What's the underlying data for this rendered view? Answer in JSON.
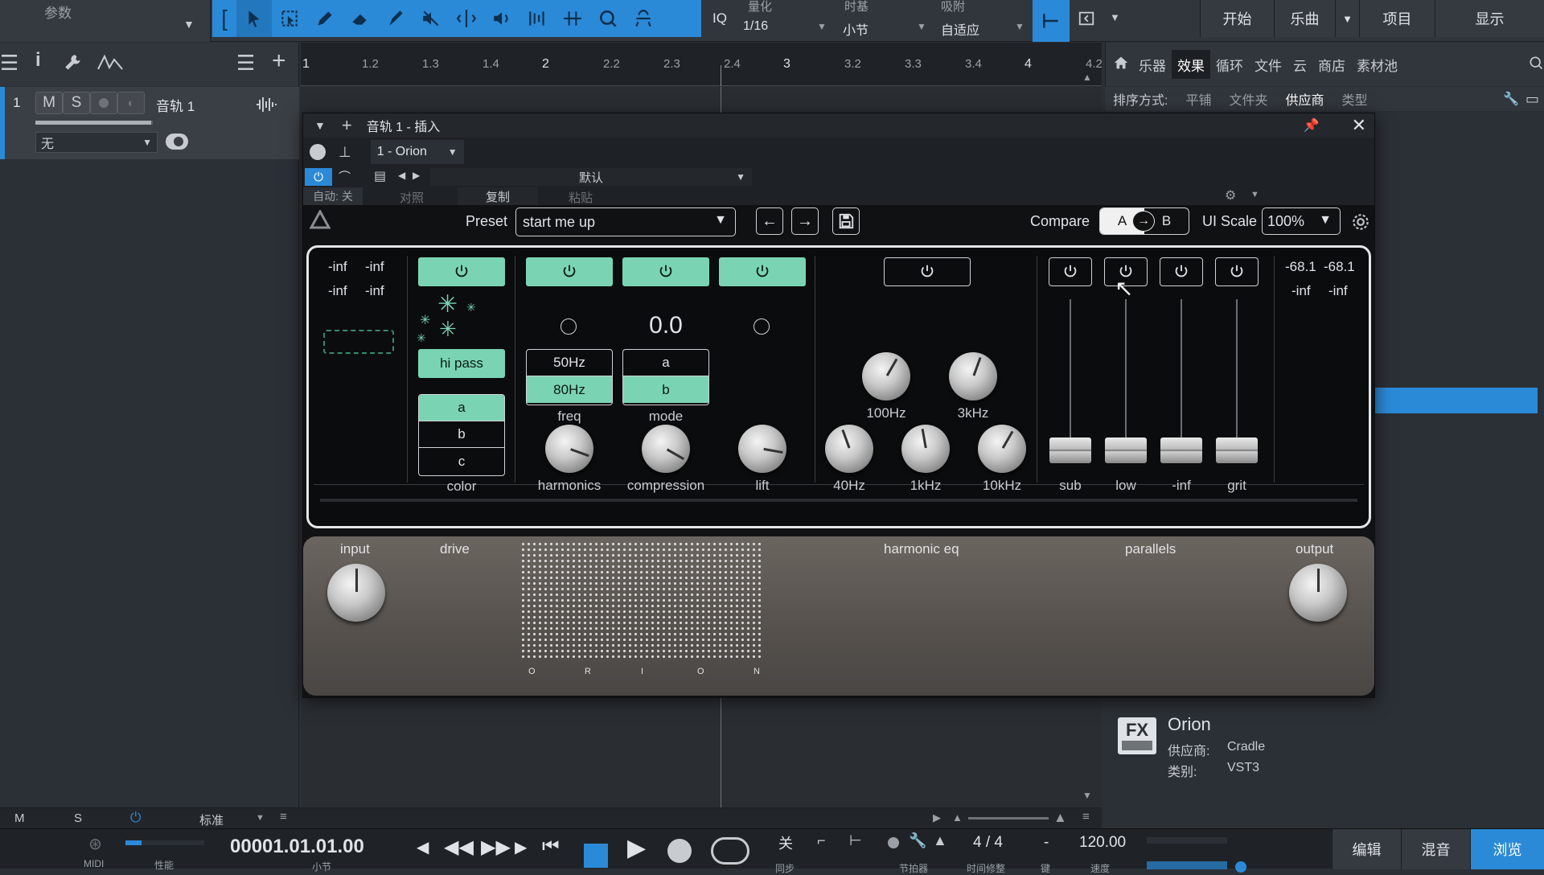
{
  "toolbar": {
    "params_label": "参数",
    "iq_label": "IQ",
    "quantize": {
      "caption": "量化",
      "value": "1/16"
    },
    "timebase": {
      "caption": "时基",
      "value": "小节"
    },
    "snap": {
      "caption": "吸附",
      "value": "自适应"
    },
    "nav": [
      "开始",
      "乐曲",
      "项目",
      "显示"
    ]
  },
  "ruler": {
    "ticks": [
      "1",
      "1.2",
      "1.3",
      "1.4",
      "2",
      "2.2",
      "2.3",
      "2.4",
      "3",
      "3.2",
      "3.3",
      "3.4",
      "4",
      "4.2"
    ]
  },
  "track": {
    "number": "1",
    "mute": "M",
    "solo": "S",
    "name": "音轨 1",
    "input": "无"
  },
  "browser": {
    "tabs": [
      "乐器",
      "效果",
      "循环",
      "文件",
      "云",
      "商店",
      "素材池"
    ],
    "active_tab": "效果",
    "sort_label": "排序方式:",
    "sort_options": [
      "平铺",
      "文件夹",
      "供应商",
      "类型"
    ],
    "active_sort": "供应商",
    "fx": {
      "badge": "FX",
      "name": "Orion",
      "vendor_label": "供应商:",
      "vendor": "Cradle",
      "category_label": "类别:",
      "category": "VST3"
    }
  },
  "plugin_window": {
    "title": "音轨 1 - 插入",
    "slot": "1 - Orion",
    "preset_default": "默认",
    "auto_label": "自动: 关",
    "compare_label": "对照",
    "copy_label": "复制",
    "paste_label": "粘贴"
  },
  "orion": {
    "preset_label": "Preset",
    "preset_value": "start me up",
    "compare_label": "Compare",
    "compare_a": "A",
    "compare_b": "B",
    "ui_scale_label": "UI Scale",
    "ui_scale_value": "100%",
    "input_meter": {
      "l1": "-inf",
      "r1": "-inf",
      "l2": "-inf",
      "r2": "-inf"
    },
    "output_meter": {
      "l1": "-68.1",
      "r1": "-68.1",
      "l2": "-inf",
      "r2": "-inf"
    },
    "hipass_label": "hi pass",
    "color_options": [
      "a",
      "b",
      "c"
    ],
    "color_selected": "a",
    "color_label": "color",
    "mode_value": "0.0",
    "freq_options": [
      "50Hz",
      "80Hz"
    ],
    "freq_selected": "80Hz",
    "freq_label": "freq",
    "mode_options": [
      "a",
      "b"
    ],
    "mode_selected": "b",
    "mode_label": "mode",
    "drive_knobs": [
      "harmonics",
      "compression",
      "lift"
    ],
    "eq_top_knobs": [
      "100Hz",
      "3kHz"
    ],
    "eq_bottom_knobs": [
      "40Hz",
      "1kHz",
      "10kHz"
    ],
    "parallel_faders": [
      "sub",
      "low",
      "-inf",
      "grit"
    ],
    "hardware": {
      "input": "input",
      "drive": "drive",
      "harmonic_eq": "harmonic eq",
      "parallels": "parallels",
      "output": "output",
      "brand_letters": [
        "O",
        "R",
        "I",
        "O",
        "N"
      ]
    }
  },
  "statusbar": {
    "m": "M",
    "s": "S",
    "mode": "标准"
  },
  "transport": {
    "midi": "MIDI",
    "perf": "性能",
    "time": "00001.01.01.00",
    "time_unit": "小节",
    "loop_off": "关",
    "sync": "同步",
    "metronome": "节拍器",
    "signature": "4 / 4",
    "sig_caption": "时间修整",
    "key": "-",
    "key_caption": "键",
    "tempo": "120.00",
    "tempo_caption": "速度",
    "tabs": [
      "编辑",
      "混音",
      "浏览"
    ],
    "active_tab": "浏览"
  },
  "colors": {
    "accent": "#2b8ad8",
    "mint": "#7ad4b3"
  }
}
